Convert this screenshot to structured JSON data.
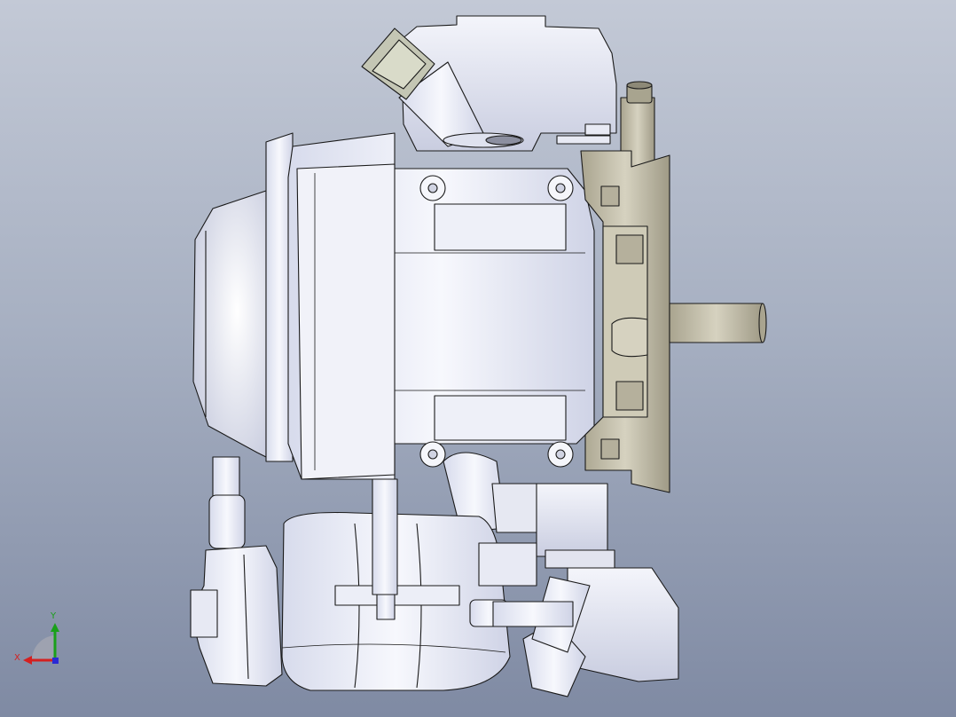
{
  "viewport": {
    "background_top": "#c3c9d6",
    "background_bottom": "#7f8aa3",
    "model_fill": "#eef0f8",
    "model_edge": "#1a1a1a",
    "bronze_fill": "#bdb8a4"
  },
  "triad": {
    "x_label": "X",
    "y_label": "Y",
    "x_color": "#d42020",
    "y_color": "#1aa01a",
    "z_color": "#2a2ad4"
  }
}
